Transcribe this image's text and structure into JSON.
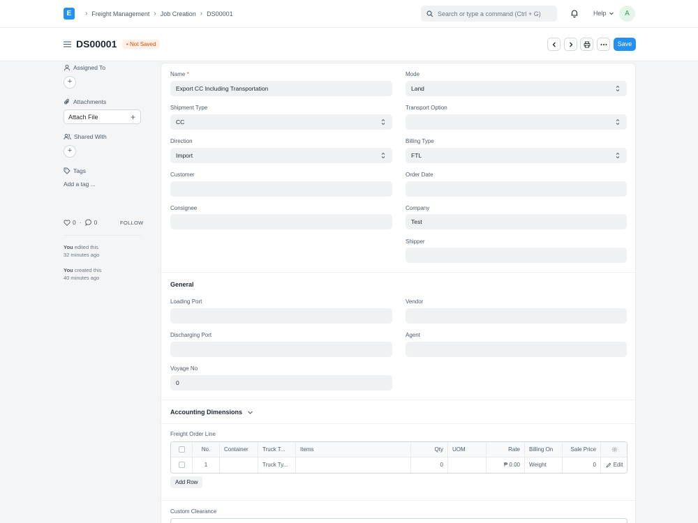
{
  "navbar": {
    "logo_letter": "E",
    "breadcrumbs": [
      "Freight Management",
      "Job Creation",
      "DS00001"
    ],
    "search_placeholder": "Search or type a command (Ctrl + G)",
    "help_label": "Help",
    "avatar_initial": "A"
  },
  "page": {
    "title": "DS00001",
    "status": "Not Saved",
    "save_label": "Save"
  },
  "sidebar": {
    "assigned_to": "Assigned To",
    "attachments": "Attachments",
    "attach_file": "Attach File",
    "shared_with": "Shared With",
    "tags": "Tags",
    "add_tag": "Add a tag ...",
    "likes": "0",
    "comments": "0",
    "follow": "FOLLOW",
    "activity": [
      {
        "who": "You",
        "action": "edited this",
        "when": "32 minutes ago"
      },
      {
        "who": "You",
        "action": "created this",
        "when": "40 minutes ago"
      }
    ]
  },
  "form": {
    "name_label": "Name",
    "name_value": "Export CC Including Transportation",
    "mode_label": "Mode",
    "mode_value": "Land",
    "shipment_type_label": "Shipment Type",
    "shipment_type_value": "CC",
    "transport_option_label": "Transport Option",
    "transport_option_value": "",
    "direction_label": "Direction",
    "direction_value": "Import",
    "billing_type_label": "Billing Type",
    "billing_type_value": "FTL",
    "customer_label": "Customer",
    "customer_value": "",
    "order_date_label": "Order Date",
    "order_date_value": "",
    "consignee_label": "Consignee",
    "consignee_value": "",
    "company_label": "Company",
    "company_value": "Test",
    "shipper_label": "Shipper",
    "shipper_value": ""
  },
  "general": {
    "title": "General",
    "loading_port_label": "Loading Port",
    "vendor_label": "Vendor",
    "discharging_port_label": "Discharging Port",
    "agent_label": "Agent",
    "voyage_no_label": "Voyage No",
    "voyage_no_value": "0"
  },
  "accounting": {
    "title": "Accounting Dimensions"
  },
  "freight_order_line": {
    "label": "Freight Order Line",
    "columns": [
      "No.",
      "Container",
      "Truck T...",
      "Items",
      "Qty",
      "UOM",
      "Rate",
      "Billing On",
      "Sale Price"
    ],
    "rows": [
      {
        "no": "1",
        "container": "",
        "truck": "Truck Ty...",
        "items": "",
        "qty": "0",
        "uom": "",
        "rate": "₱ 0.00",
        "billing_on": "Weight",
        "sale_price": "0",
        "edit": "Edit"
      }
    ],
    "add_row": "Add Row"
  },
  "custom_clearance": {
    "label": "Custom Clearance"
  },
  "colors": {
    "primary": "#2490ef",
    "badge_text": "#e24c00",
    "badge_bg": "#fff1e7"
  }
}
